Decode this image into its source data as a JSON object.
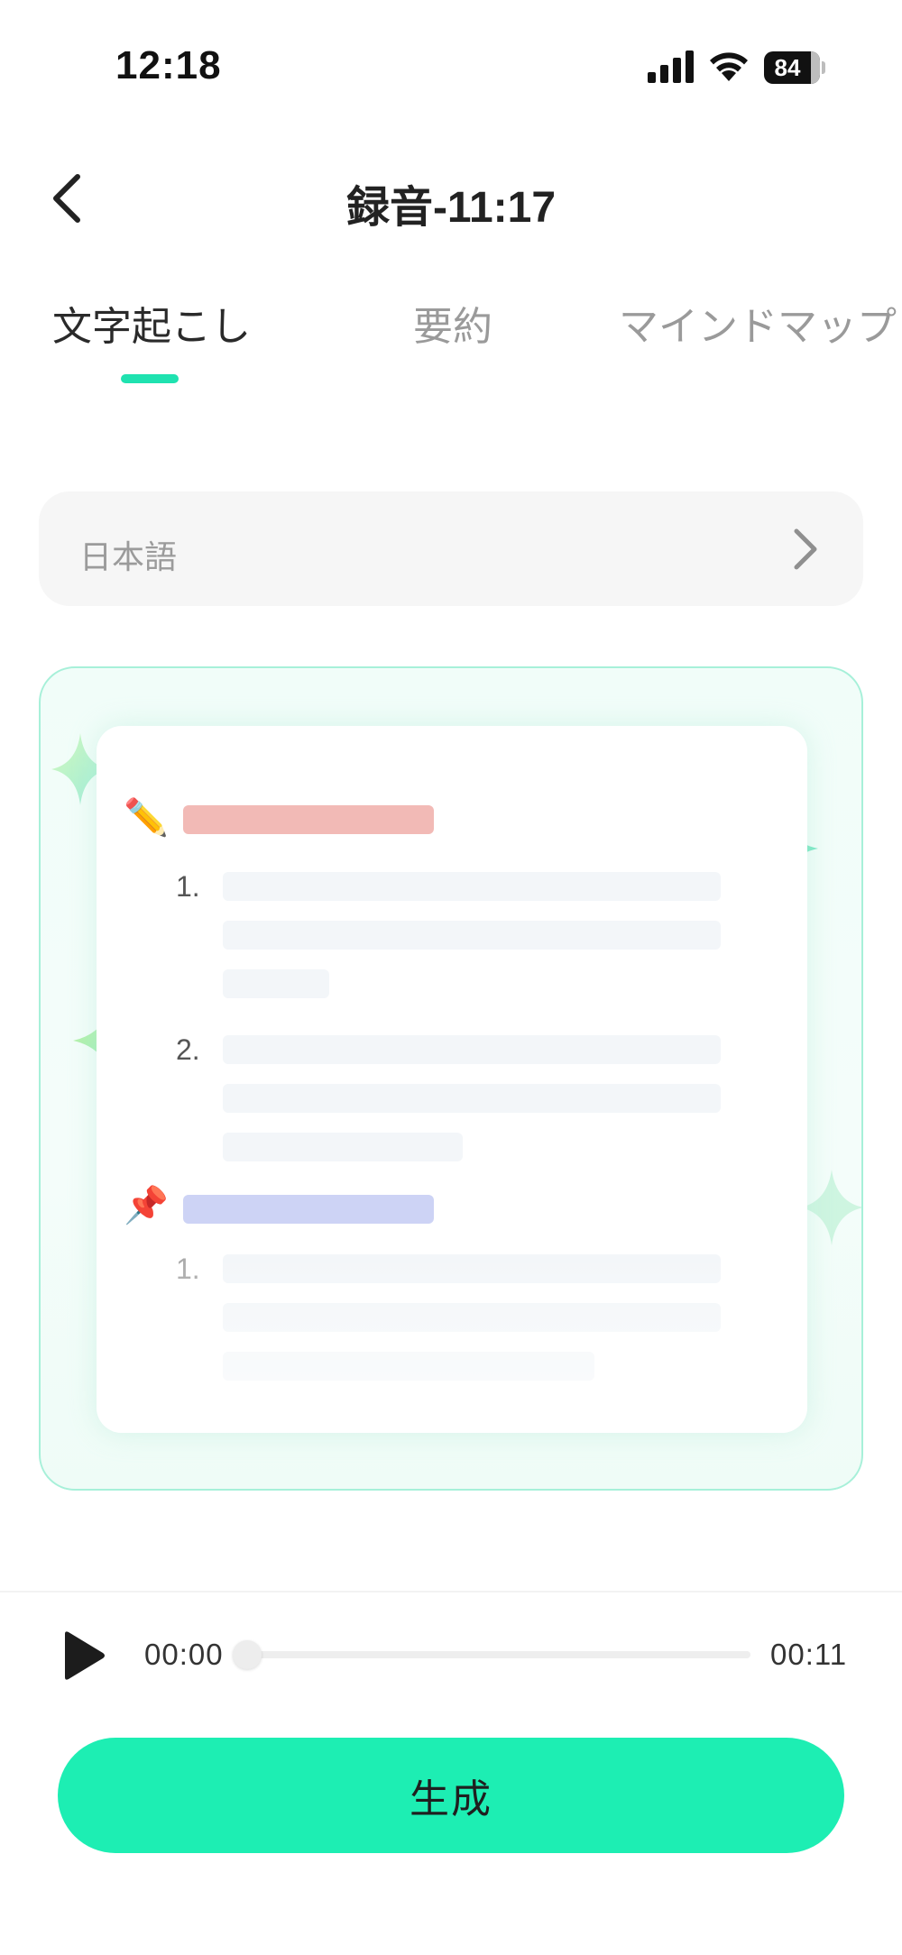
{
  "status_bar": {
    "time": "12:18",
    "battery_level": "84",
    "icons": [
      "signal-icon",
      "wifi-icon",
      "battery-icon"
    ]
  },
  "header": {
    "title": "録音-11:17",
    "back_icon": "chevron-left-icon"
  },
  "tabs": [
    {
      "label": "文字起こし",
      "active": true
    },
    {
      "label": "要約",
      "active": false
    },
    {
      "label": "マインドマップ",
      "active": false
    }
  ],
  "language_selector": {
    "value": "日本語",
    "icon": "chevron-right-icon"
  },
  "illustration": {
    "section_icons": [
      "pencil-icon",
      "pushpin-icon"
    ],
    "list_numbers": [
      "1.",
      "2.",
      "1."
    ],
    "colors": {
      "heading_1": "#f2bab6",
      "heading_2": "#cdd3f5",
      "placeholder_line": "#f3f6f9",
      "border": "#a7f0d9"
    }
  },
  "player": {
    "current_time": "00:00",
    "total_time": "00:11",
    "progress": 0,
    "play_icon": "play-icon"
  },
  "actions": {
    "generate_label": "生成"
  },
  "colors": {
    "accent": "#1fe2b0",
    "button": "#1deeb3"
  }
}
